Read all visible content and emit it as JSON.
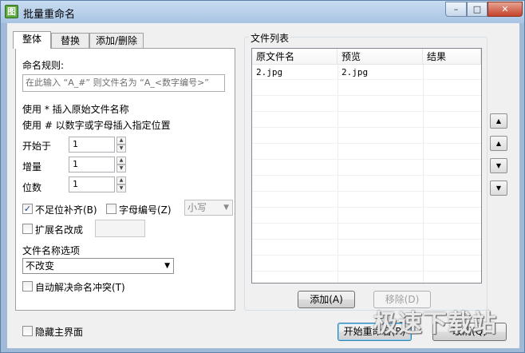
{
  "window": {
    "title": "批量重命名",
    "icon": "app-icon",
    "controls": {
      "minimize": "–",
      "maximize": "□",
      "close": "✕"
    }
  },
  "tabs": [
    {
      "label": "整体",
      "active": true
    },
    {
      "label": "替换",
      "active": false
    },
    {
      "label": "添加/删除",
      "active": false
    }
  ],
  "naming": {
    "rule_label": "命名规则:",
    "rule_placeholder": "在此输入 “A_#” 则文件名为 “A_<数字编号>”",
    "hint1": "使用 * 插入原始文件名称",
    "hint2": "使用 # 以数字或字母插入指定位置",
    "start_label": "开始于",
    "start_value": "1",
    "increment_label": "增量",
    "increment_value": "1",
    "digits_label": "位数",
    "digits_value": "1",
    "pad_label": "不足位补齐(B)",
    "pad_checked": true,
    "letter_label": "字母编号(Z)",
    "letter_checked": false,
    "case_value": "小写",
    "ext_label": "扩展名改成",
    "ext_checked": false,
    "ext_value": "",
    "options_label": "文件名称选项",
    "options_value": "不改变",
    "conflict_label": "自动解决命名冲突(T)",
    "conflict_checked": false
  },
  "file_list": {
    "title": "文件列表",
    "columns": [
      "原文件名",
      "预览",
      "结果"
    ],
    "rows": [
      {
        "original": "2.jpg",
        "preview": "2.jpg",
        "result": ""
      }
    ],
    "add_button": "添加(A)",
    "remove_button": "移除(D)"
  },
  "side_buttons": {
    "top": "▲̅",
    "up": "▲",
    "down": "▼",
    "bottom": "▼̲"
  },
  "footer": {
    "hide_main_label": "隐藏主界面",
    "hide_main_checked": false,
    "start_button": "开始重命名(R)",
    "cancel_button": "取消(Q)"
  },
  "watermark": "极速下载站"
}
